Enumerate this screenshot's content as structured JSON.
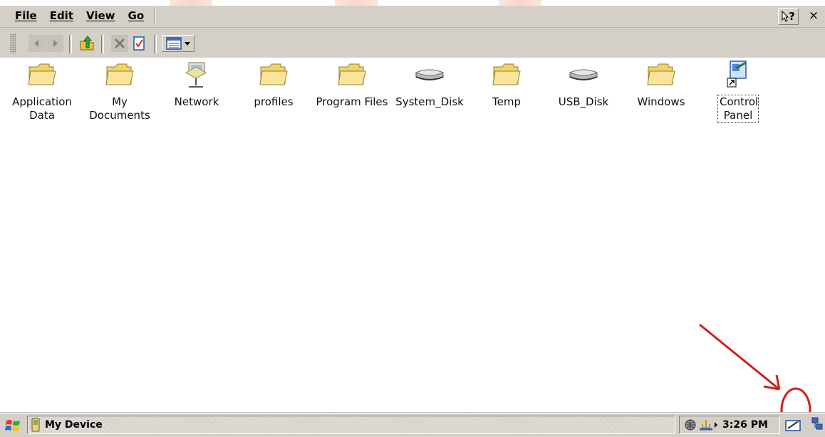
{
  "menubar": {
    "items": [
      "File",
      "Edit",
      "View",
      "Go"
    ],
    "help_label": "?",
    "close_label": "×"
  },
  "toolbar": {
    "buttons": [
      "back-icon",
      "forward-icon",
      "up-folder-icon",
      "delete-icon",
      "properties-icon",
      "views-icon"
    ]
  },
  "items": [
    {
      "label": "Application Data",
      "icon": "folder-icon"
    },
    {
      "label": "My Documents",
      "icon": "folder-icon"
    },
    {
      "label": "Network",
      "icon": "network-icon"
    },
    {
      "label": "profiles",
      "icon": "folder-icon"
    },
    {
      "label": "Program Files",
      "icon": "folder-icon"
    },
    {
      "label": "System_Disk",
      "icon": "disk-icon"
    },
    {
      "label": "Temp",
      "icon": "folder-icon"
    },
    {
      "label": "USB_Disk",
      "icon": "disk-icon"
    },
    {
      "label": "Windows",
      "icon": "folder-icon"
    },
    {
      "label": "Control Panel",
      "icon": "control-panel-icon",
      "selected": true
    }
  ],
  "taskbar": {
    "task_label": "My Device",
    "clock": "3:26 PM"
  },
  "colors": {
    "chrome": "#d4d0c8",
    "folder": "#f6e08a",
    "annotation": "#d0201c"
  }
}
